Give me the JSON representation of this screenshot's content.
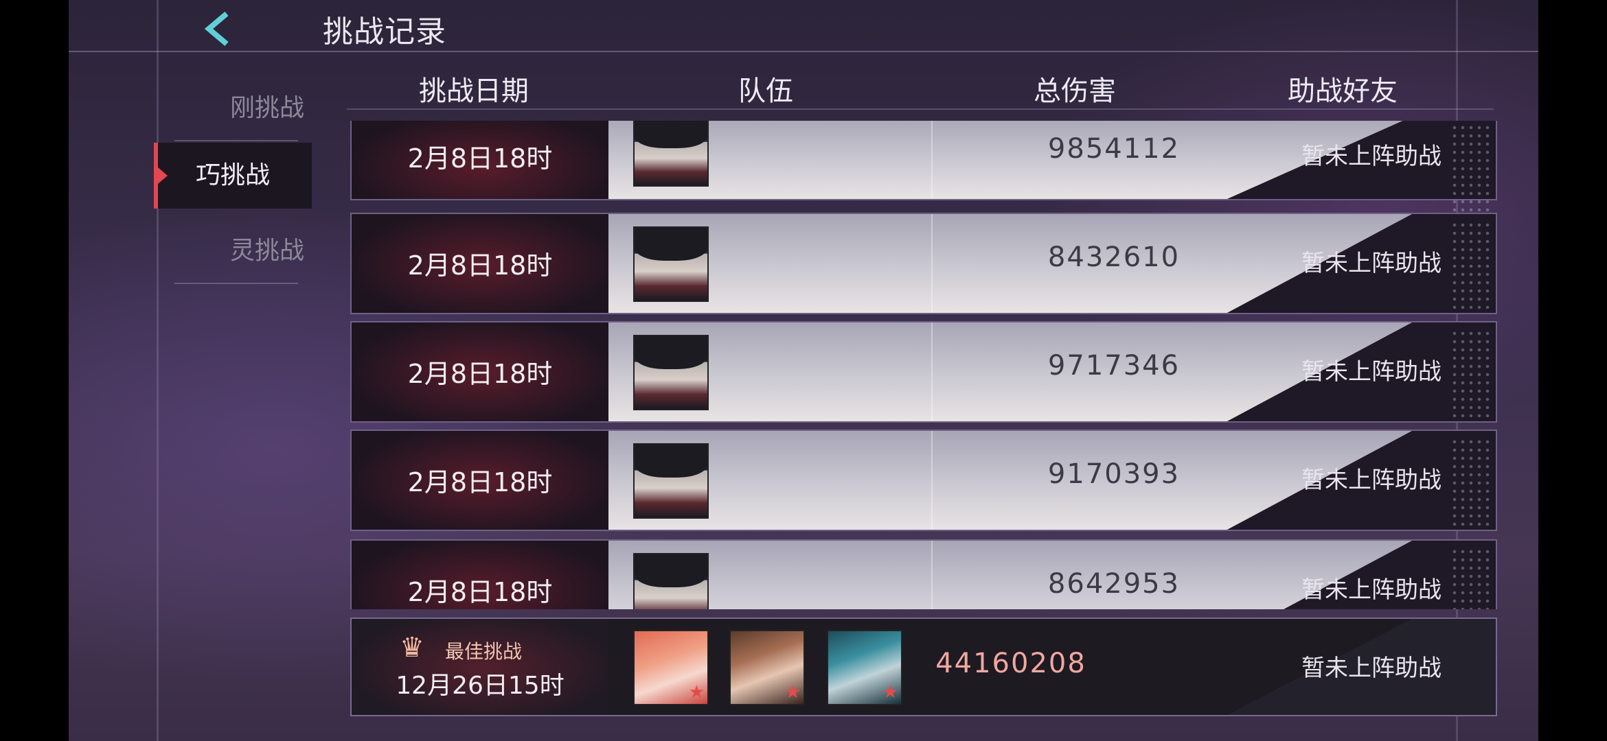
{
  "header": {
    "title": "挑战记录"
  },
  "sidebar": {
    "items": [
      {
        "label": "刚挑战",
        "active": false
      },
      {
        "label": "巧挑战",
        "active": true
      },
      {
        "label": "灵挑战",
        "active": false
      }
    ]
  },
  "table": {
    "columns": [
      "挑战日期",
      "队伍",
      "总伤害",
      "助战好友"
    ],
    "rows": [
      {
        "date": "2月8日18时",
        "damage": "9854112",
        "helper": "暂未上阵助战",
        "team": [
          "dark-haired-character"
        ]
      },
      {
        "date": "2月8日18时",
        "damage": "8432610",
        "helper": "暂未上阵助战",
        "team": [
          "dark-haired-character"
        ]
      },
      {
        "date": "2月8日18时",
        "damage": "9717346",
        "helper": "暂未上阵助战",
        "team": [
          "dark-haired-character"
        ]
      },
      {
        "date": "2月8日18时",
        "damage": "9170393",
        "helper": "暂未上阵助战",
        "team": [
          "dark-haired-character"
        ]
      },
      {
        "date": "2月8日18时",
        "damage": "8642953",
        "helper": "暂未上阵助战",
        "team": [
          "dark-haired-character"
        ]
      }
    ],
    "best": {
      "label": "最佳挑战",
      "date": "12月26日15时",
      "damage": "44160208",
      "helper": "暂未上阵助战",
      "team": [
        "red-haired-character",
        "brown-haired-character",
        "teal-haired-character"
      ]
    }
  },
  "colors": {
    "accent": "#e3474f",
    "back_arrow": "#5fd0d8",
    "best_damage": "#f1a7a0"
  }
}
